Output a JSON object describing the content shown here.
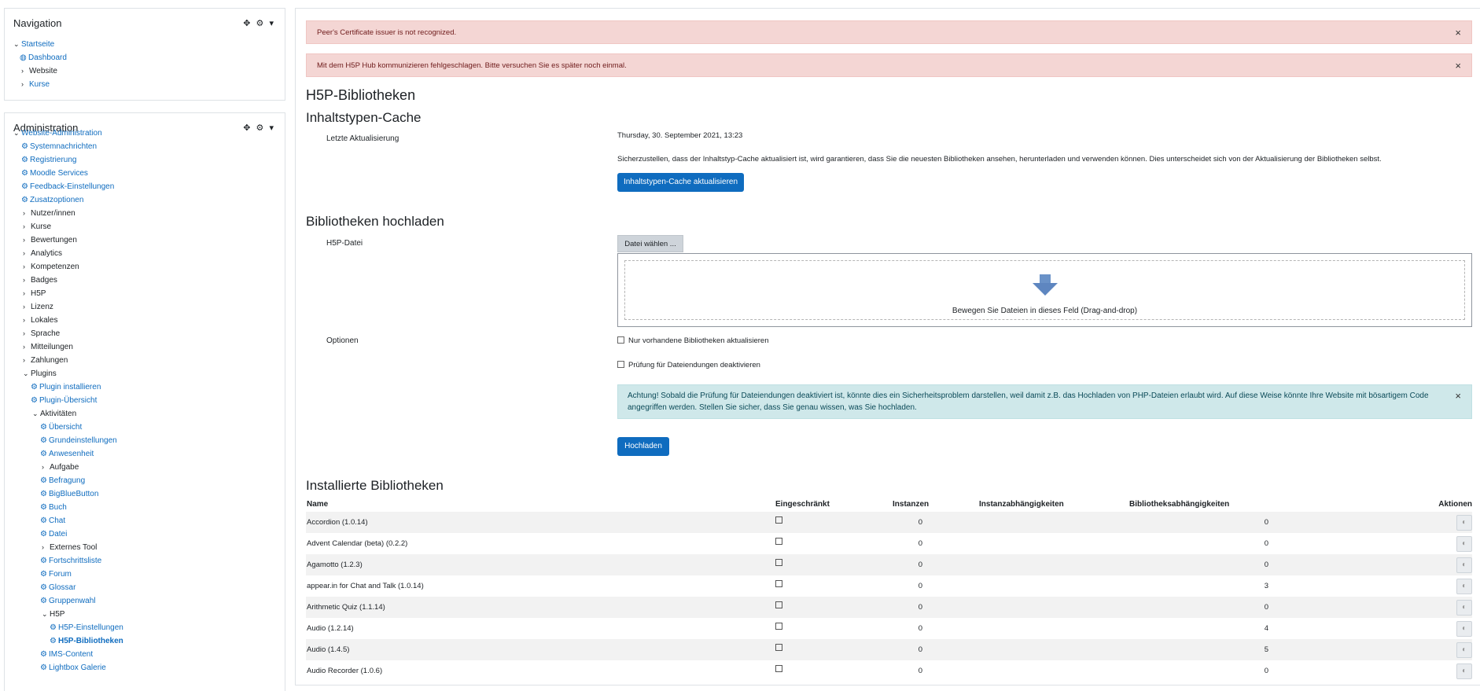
{
  "navigation": {
    "title": "Navigation",
    "controls": "✥ ⚙ ▾",
    "items": [
      {
        "label": "Startseite"
      },
      {
        "label": "Dashboard"
      },
      {
        "label": "Website"
      },
      {
        "label": "Kurse"
      }
    ]
  },
  "administration": {
    "title": "Administration",
    "controls": "✥ ⚙ ▾",
    "items": [
      {
        "label": "Website-Administration"
      },
      {
        "label": "Systemnachrichten"
      },
      {
        "label": "Registrierung"
      },
      {
        "label": "Moodle Services"
      },
      {
        "label": "Feedback-Einstellungen"
      },
      {
        "label": "Zusatzoptionen"
      },
      {
        "label": "Nutzer/innen"
      },
      {
        "label": "Kurse"
      },
      {
        "label": "Bewertungen"
      },
      {
        "label": "Analytics"
      },
      {
        "label": "Kompetenzen"
      },
      {
        "label": "Badges"
      },
      {
        "label": "H5P"
      },
      {
        "label": "Lizenz"
      },
      {
        "label": "Lokales"
      },
      {
        "label": "Sprache"
      },
      {
        "label": "Mitteilungen"
      },
      {
        "label": "Zahlungen"
      },
      {
        "label": "Plugins"
      },
      {
        "label": "Plugin installieren"
      },
      {
        "label": "Plugin-Übersicht"
      },
      {
        "label": "Aktivitäten"
      },
      {
        "label": "Übersicht"
      },
      {
        "label": "Grundeinstellungen"
      },
      {
        "label": "Anwesenheit"
      },
      {
        "label": "Aufgabe"
      },
      {
        "label": "Befragung"
      },
      {
        "label": "BigBlueButton"
      },
      {
        "label": "Buch"
      },
      {
        "label": "Chat"
      },
      {
        "label": "Datei"
      },
      {
        "label": "Externes Tool"
      },
      {
        "label": "Fortschrittsliste"
      },
      {
        "label": "Forum"
      },
      {
        "label": "Glossar"
      },
      {
        "label": "Gruppenwahl"
      },
      {
        "label": "H5P"
      },
      {
        "label": "H5P-Einstellungen"
      },
      {
        "label": "H5P-Bibliotheken"
      },
      {
        "label": "IMS-Content"
      },
      {
        "label": "Lightbox Galerie"
      }
    ]
  },
  "alerts": [
    {
      "text": "Peer's Certificate issuer is not recognized."
    },
    {
      "text": "Mit dem H5P Hub kommunizieren fehlgeschlagen. Bitte versuchen Sie es später noch einmal."
    }
  ],
  "close_glyph": "×",
  "page_title": "H5P-Bibliotheken",
  "cache": {
    "heading": "Inhaltstypen-Cache",
    "last_update_label": "Letzte Aktualisierung",
    "last_update_value": "Thursday, 30. September 2021, 13:23",
    "description": "Sicherzustellen, dass der Inhaltstyp-Cache aktualisiert ist, wird garantieren, dass Sie die neuesten Bibliotheken ansehen, herunterladen und verwenden können. Dies unterscheidet sich von der Aktualisierung der Bibliotheken selbst.",
    "button": "Inhaltstypen-Cache aktualisieren"
  },
  "upload": {
    "heading": "Bibliotheken hochladen",
    "file_label": "H5P-Datei",
    "choose_file": "Datei wählen ...",
    "drop_text": "Bewegen Sie Dateien in dieses Feld (Drag-and-drop)",
    "options_label": "Optionen",
    "option1": "Nur vorhandene Bibliotheken aktualisieren",
    "option2": "Prüfung für Dateiendungen deaktivieren",
    "warning": "Achtung! Sobald die Prüfung für Dateiendungen deaktiviert ist, könnte dies ein Sicherheitsproblem darstellen, weil damit z.B. das Hochladen von PHP-Dateien erlaubt wird. Auf diese Weise könnte Ihre Website mit bösartigem Code angegriffen werden. Stellen Sie sicher, dass Sie genau wissen, was Sie hochladen.",
    "upload_button": "Hochladen"
  },
  "installed": {
    "heading": "Installierte Bibliotheken",
    "columns": {
      "name": "Name",
      "restricted": "Eingeschränkt",
      "instances": "Instanzen",
      "instance_deps": "Instanzabhängigkeiten",
      "library_deps": "Bibliotheksabhängigkeiten",
      "actions": "Aktionen"
    },
    "rows": [
      {
        "name": "Accordion (1.0.14)",
        "instances": "0",
        "instance_deps": "",
        "library_deps": "0"
      },
      {
        "name": "Advent Calendar (beta) (0.2.2)",
        "instances": "0",
        "instance_deps": "",
        "library_deps": "0"
      },
      {
        "name": "Agamotto (1.2.3)",
        "instances": "0",
        "instance_deps": "",
        "library_deps": "0"
      },
      {
        "name": "appear.in for Chat and Talk (1.0.14)",
        "instances": "0",
        "instance_deps": "",
        "library_deps": "3"
      },
      {
        "name": "Arithmetic Quiz (1.1.14)",
        "instances": "0",
        "instance_deps": "",
        "library_deps": "0"
      },
      {
        "name": "Audio (1.2.14)",
        "instances": "0",
        "instance_deps": "",
        "library_deps": "4"
      },
      {
        "name": "Audio (1.4.5)",
        "instances": "0",
        "instance_deps": "",
        "library_deps": "5"
      },
      {
        "name": "Audio Recorder (1.0.6)",
        "instances": "0",
        "instance_deps": "",
        "library_deps": "0"
      }
    ]
  }
}
